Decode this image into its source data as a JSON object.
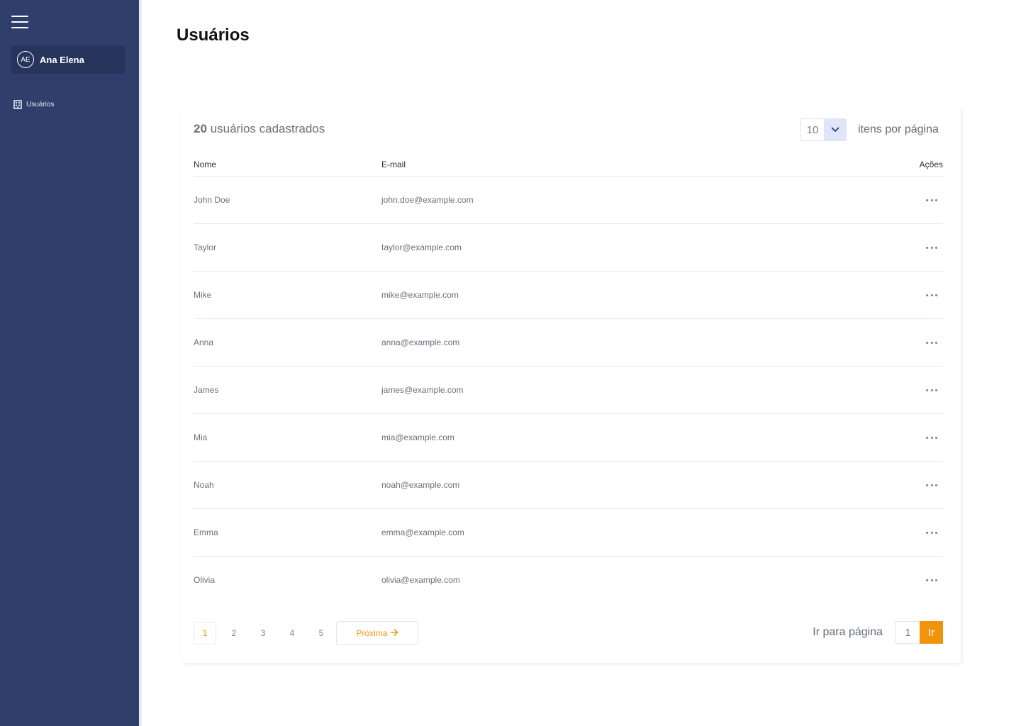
{
  "colors": {
    "sidebar": "#2f3e6b",
    "accent": "#f2930e",
    "select_arrow_bg": "#dfe6fb"
  },
  "sidebar": {
    "menu_icon": "hamburger-icon",
    "user": {
      "initials": "AE",
      "name": "Ana Elena"
    },
    "items": [
      {
        "icon": "building-icon",
        "label": "Usuários"
      }
    ]
  },
  "header": {
    "title": "Usuários"
  },
  "summary": {
    "count": "20",
    "label": "usuários cadastrados"
  },
  "per_page": {
    "value": "10",
    "label": "itens por página",
    "icon": "chevron-down-icon"
  },
  "table": {
    "columns": [
      "Nome",
      "E-mail",
      "Ações"
    ],
    "rows": [
      {
        "name": "John Doe",
        "email": "john.doe@example.com"
      },
      {
        "name": "Taylor",
        "email": "taylor@example.com"
      },
      {
        "name": "Mike",
        "email": "mike@example.com"
      },
      {
        "name": "Anna",
        "email": "anna@example.com"
      },
      {
        "name": "James",
        "email": "james@example.com"
      },
      {
        "name": "Mia",
        "email": "mia@example.com"
      },
      {
        "name": "Noah",
        "email": "noah@example.com"
      },
      {
        "name": "Emma",
        "email": "emma@example.com"
      },
      {
        "name": "Olivia",
        "email": "olivia@example.com"
      }
    ],
    "action_icon": "more-horizontal-icon"
  },
  "pagination": {
    "pages": [
      "1",
      "2",
      "3",
      "4",
      "5"
    ],
    "current": "1",
    "next_label": "Próxima",
    "next_icon": "arrow-right-icon"
  },
  "goto": {
    "label": "Ir para página",
    "value": "1",
    "button": "Ir"
  }
}
